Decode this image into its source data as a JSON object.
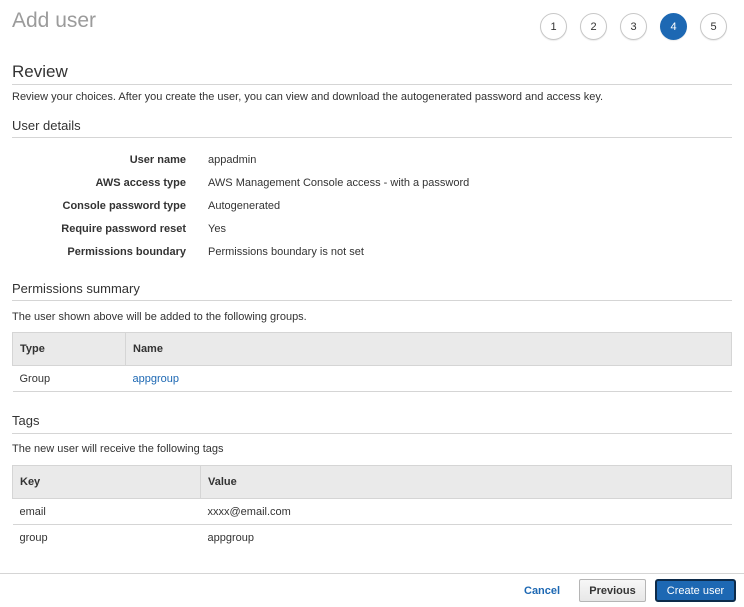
{
  "header": {
    "title": "Add user",
    "steps": [
      "1",
      "2",
      "3",
      "4",
      "5"
    ],
    "active_step": "4"
  },
  "review": {
    "title": "Review",
    "description": "Review your choices. After you create the user, you can view and download the autogenerated password and access key."
  },
  "user_details": {
    "title": "User details",
    "rows": [
      {
        "label": "User name",
        "value": "appadmin"
      },
      {
        "label": "AWS access type",
        "value": "AWS Management Console access - with a password"
      },
      {
        "label": "Console password type",
        "value": "Autogenerated"
      },
      {
        "label": "Require password reset",
        "value": "Yes"
      },
      {
        "label": "Permissions boundary",
        "value": "Permissions boundary is not set"
      }
    ]
  },
  "permissions": {
    "title": "Permissions summary",
    "description": "The user shown above will be added to the following groups.",
    "columns": [
      "Type",
      "Name"
    ],
    "rows": [
      {
        "type": "Group",
        "name": "appgroup"
      }
    ]
  },
  "tags": {
    "title": "Tags",
    "description": "The new user will receive the following tags",
    "columns": [
      "Key",
      "Value"
    ],
    "rows": [
      {
        "key": "email",
        "value": "xxxx@email.com"
      },
      {
        "key": "group",
        "value": "appgroup"
      }
    ]
  },
  "footer": {
    "cancel_label": "Cancel",
    "previous_label": "Previous",
    "create_label": "Create user"
  }
}
